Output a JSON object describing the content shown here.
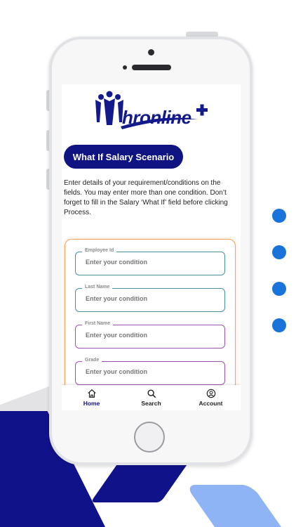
{
  "app": {
    "logo_text": "hronline"
  },
  "screen": {
    "title_button": "What If Salary Scenario",
    "intro_text": "Enter details of your requirement/conditions on the fields. You may enter more than one condition. Don’t forget to fill in the Salary ‘What If’ field before clicking Process."
  },
  "form": {
    "fields": [
      {
        "label": "Employee Id",
        "placeholder": "Enter your condition"
      },
      {
        "label": "Last Name",
        "placeholder": "Enter your condition"
      },
      {
        "label": "First Name",
        "placeholder": "Enter your condition"
      },
      {
        "label": "Grade",
        "placeholder": "Enter your condition"
      }
    ]
  },
  "nav": {
    "items": [
      {
        "label": "Home",
        "icon": "home-icon"
      },
      {
        "label": "Search",
        "icon": "search-icon"
      },
      {
        "label": "Account",
        "icon": "account-icon"
      }
    ]
  },
  "colors": {
    "brand_navy": "#0f1482",
    "accent_orange": "#f3a35d",
    "field_teal": "#4a8fa0",
    "field_purple": "#9b55b0",
    "dot_blue": "#1a73d9",
    "light_blue": "#8fb4f5"
  }
}
